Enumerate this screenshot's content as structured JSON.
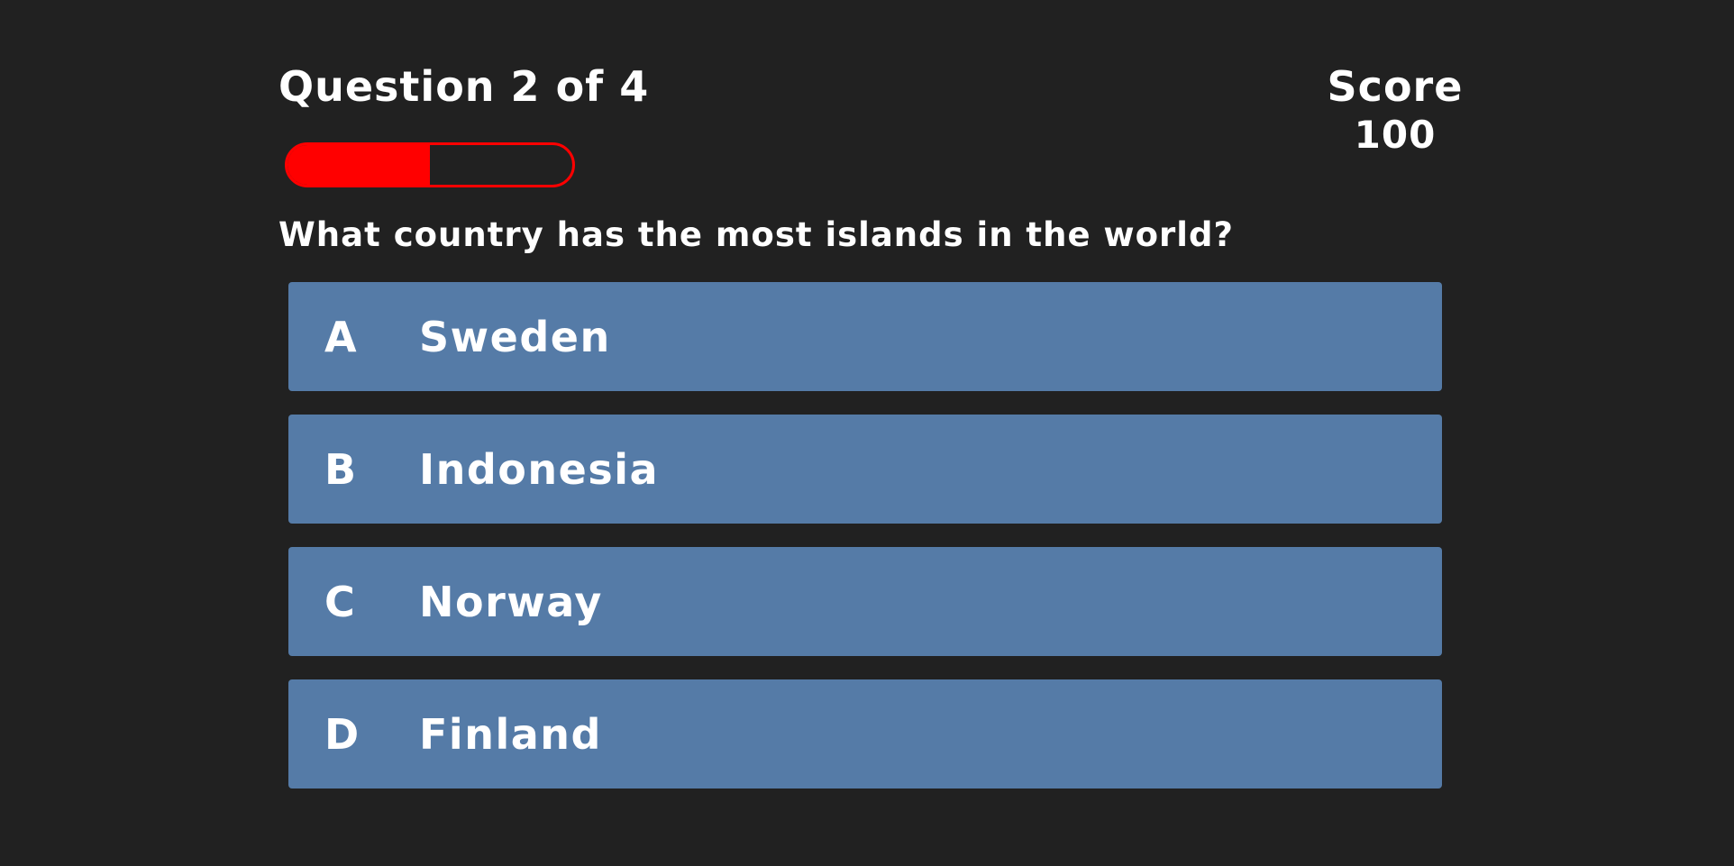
{
  "hud": {
    "progress_text": "Question 2 of 4",
    "progress_fraction": 0.5,
    "score_label": "Score",
    "score_value": "100"
  },
  "question": "What country has the most islands in the world?",
  "choices": [
    {
      "prefix": "A",
      "text": "Sweden"
    },
    {
      "prefix": "B",
      "text": "Indonesia"
    },
    {
      "prefix": "C",
      "text": "Norway"
    },
    {
      "prefix": "D",
      "text": "Finland"
    }
  ],
  "colors": {
    "background": "#212121",
    "progress": "#ff0000",
    "choice_background": "#557ba7",
    "text": "#ffffff"
  }
}
